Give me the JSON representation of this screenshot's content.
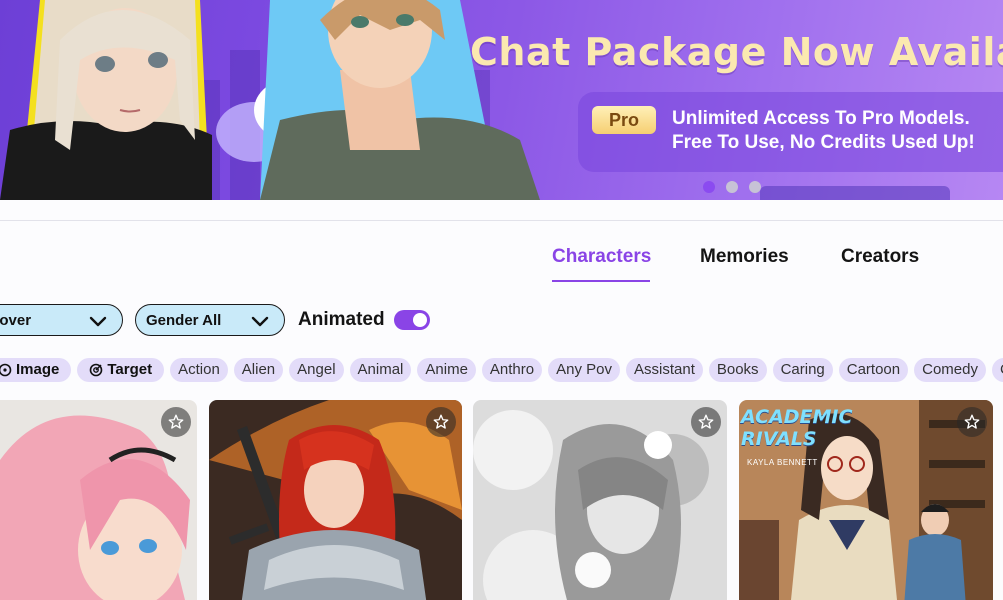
{
  "banner": {
    "title": "Chat Package Now Available",
    "badge": "Pro",
    "line1": "Unlimited Access To Pro Models.",
    "line2": "Free To Use, No Credits Used Up!",
    "slides": [
      true,
      false,
      false
    ]
  },
  "tabs": [
    {
      "label": "Characters",
      "active": true
    },
    {
      "label": "Memories",
      "active": false
    },
    {
      "label": "Creators",
      "active": false
    }
  ],
  "filters": {
    "sort_value": "Discover",
    "sort_visible": "cover",
    "gender_value": "Gender All",
    "animated_label": "Animated",
    "animated_on": true
  },
  "tags": [
    {
      "label": "Image",
      "icon": "image-icon",
      "bold": true
    },
    {
      "label": "Target",
      "icon": "target-icon",
      "bold": true
    },
    {
      "label": "Action"
    },
    {
      "label": "Alien"
    },
    {
      "label": "Angel"
    },
    {
      "label": "Animal"
    },
    {
      "label": "Anime"
    },
    {
      "label": "Anthro"
    },
    {
      "label": "Any Pov"
    },
    {
      "label": "Assistant"
    },
    {
      "label": "Books"
    },
    {
      "label": "Caring"
    },
    {
      "label": "Cartoon"
    },
    {
      "label": "Comedy"
    },
    {
      "label": "C"
    }
  ],
  "cards": [
    {
      "art": "pink-hair-girl"
    },
    {
      "art": "red-hair-knight"
    },
    {
      "art": "monochrome-flower-girl"
    },
    {
      "art": "academic-rivals-cover",
      "cover_title_1": "ACADEMIC",
      "cover_title_2": "RIVALS",
      "cover_author": "KAYLA BENNETT"
    }
  ],
  "colors": {
    "accent": "#8a44e6",
    "dropdown_bg": "#c9eaf9",
    "tag_bg": "#e3dcf9"
  }
}
